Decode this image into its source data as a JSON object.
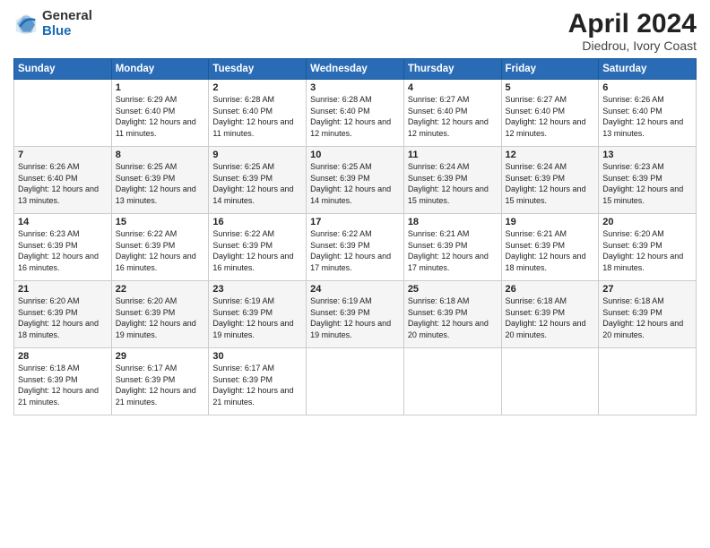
{
  "logo": {
    "line1": "General",
    "line2": "Blue"
  },
  "title": "April 2024",
  "subtitle": "Diedrou, Ivory Coast",
  "days_header": [
    "Sunday",
    "Monday",
    "Tuesday",
    "Wednesday",
    "Thursday",
    "Friday",
    "Saturday"
  ],
  "weeks": [
    [
      {
        "num": "",
        "sunrise": "",
        "sunset": "",
        "daylight": ""
      },
      {
        "num": "1",
        "sunrise": "Sunrise: 6:29 AM",
        "sunset": "Sunset: 6:40 PM",
        "daylight": "Daylight: 12 hours and 11 minutes."
      },
      {
        "num": "2",
        "sunrise": "Sunrise: 6:28 AM",
        "sunset": "Sunset: 6:40 PM",
        "daylight": "Daylight: 12 hours and 11 minutes."
      },
      {
        "num": "3",
        "sunrise": "Sunrise: 6:28 AM",
        "sunset": "Sunset: 6:40 PM",
        "daylight": "Daylight: 12 hours and 12 minutes."
      },
      {
        "num": "4",
        "sunrise": "Sunrise: 6:27 AM",
        "sunset": "Sunset: 6:40 PM",
        "daylight": "Daylight: 12 hours and 12 minutes."
      },
      {
        "num": "5",
        "sunrise": "Sunrise: 6:27 AM",
        "sunset": "Sunset: 6:40 PM",
        "daylight": "Daylight: 12 hours and 12 minutes."
      },
      {
        "num": "6",
        "sunrise": "Sunrise: 6:26 AM",
        "sunset": "Sunset: 6:40 PM",
        "daylight": "Daylight: 12 hours and 13 minutes."
      }
    ],
    [
      {
        "num": "7",
        "sunrise": "Sunrise: 6:26 AM",
        "sunset": "Sunset: 6:40 PM",
        "daylight": "Daylight: 12 hours and 13 minutes."
      },
      {
        "num": "8",
        "sunrise": "Sunrise: 6:25 AM",
        "sunset": "Sunset: 6:39 PM",
        "daylight": "Daylight: 12 hours and 13 minutes."
      },
      {
        "num": "9",
        "sunrise": "Sunrise: 6:25 AM",
        "sunset": "Sunset: 6:39 PM",
        "daylight": "Daylight: 12 hours and 14 minutes."
      },
      {
        "num": "10",
        "sunrise": "Sunrise: 6:25 AM",
        "sunset": "Sunset: 6:39 PM",
        "daylight": "Daylight: 12 hours and 14 minutes."
      },
      {
        "num": "11",
        "sunrise": "Sunrise: 6:24 AM",
        "sunset": "Sunset: 6:39 PM",
        "daylight": "Daylight: 12 hours and 15 minutes."
      },
      {
        "num": "12",
        "sunrise": "Sunrise: 6:24 AM",
        "sunset": "Sunset: 6:39 PM",
        "daylight": "Daylight: 12 hours and 15 minutes."
      },
      {
        "num": "13",
        "sunrise": "Sunrise: 6:23 AM",
        "sunset": "Sunset: 6:39 PM",
        "daylight": "Daylight: 12 hours and 15 minutes."
      }
    ],
    [
      {
        "num": "14",
        "sunrise": "Sunrise: 6:23 AM",
        "sunset": "Sunset: 6:39 PM",
        "daylight": "Daylight: 12 hours and 16 minutes."
      },
      {
        "num": "15",
        "sunrise": "Sunrise: 6:22 AM",
        "sunset": "Sunset: 6:39 PM",
        "daylight": "Daylight: 12 hours and 16 minutes."
      },
      {
        "num": "16",
        "sunrise": "Sunrise: 6:22 AM",
        "sunset": "Sunset: 6:39 PM",
        "daylight": "Daylight: 12 hours and 16 minutes."
      },
      {
        "num": "17",
        "sunrise": "Sunrise: 6:22 AM",
        "sunset": "Sunset: 6:39 PM",
        "daylight": "Daylight: 12 hours and 17 minutes."
      },
      {
        "num": "18",
        "sunrise": "Sunrise: 6:21 AM",
        "sunset": "Sunset: 6:39 PM",
        "daylight": "Daylight: 12 hours and 17 minutes."
      },
      {
        "num": "19",
        "sunrise": "Sunrise: 6:21 AM",
        "sunset": "Sunset: 6:39 PM",
        "daylight": "Daylight: 12 hours and 18 minutes."
      },
      {
        "num": "20",
        "sunrise": "Sunrise: 6:20 AM",
        "sunset": "Sunset: 6:39 PM",
        "daylight": "Daylight: 12 hours and 18 minutes."
      }
    ],
    [
      {
        "num": "21",
        "sunrise": "Sunrise: 6:20 AM",
        "sunset": "Sunset: 6:39 PM",
        "daylight": "Daylight: 12 hours and 18 minutes."
      },
      {
        "num": "22",
        "sunrise": "Sunrise: 6:20 AM",
        "sunset": "Sunset: 6:39 PM",
        "daylight": "Daylight: 12 hours and 19 minutes."
      },
      {
        "num": "23",
        "sunrise": "Sunrise: 6:19 AM",
        "sunset": "Sunset: 6:39 PM",
        "daylight": "Daylight: 12 hours and 19 minutes."
      },
      {
        "num": "24",
        "sunrise": "Sunrise: 6:19 AM",
        "sunset": "Sunset: 6:39 PM",
        "daylight": "Daylight: 12 hours and 19 minutes."
      },
      {
        "num": "25",
        "sunrise": "Sunrise: 6:18 AM",
        "sunset": "Sunset: 6:39 PM",
        "daylight": "Daylight: 12 hours and 20 minutes."
      },
      {
        "num": "26",
        "sunrise": "Sunrise: 6:18 AM",
        "sunset": "Sunset: 6:39 PM",
        "daylight": "Daylight: 12 hours and 20 minutes."
      },
      {
        "num": "27",
        "sunrise": "Sunrise: 6:18 AM",
        "sunset": "Sunset: 6:39 PM",
        "daylight": "Daylight: 12 hours and 20 minutes."
      }
    ],
    [
      {
        "num": "28",
        "sunrise": "Sunrise: 6:18 AM",
        "sunset": "Sunset: 6:39 PM",
        "daylight": "Daylight: 12 hours and 21 minutes."
      },
      {
        "num": "29",
        "sunrise": "Sunrise: 6:17 AM",
        "sunset": "Sunset: 6:39 PM",
        "daylight": "Daylight: 12 hours and 21 minutes."
      },
      {
        "num": "30",
        "sunrise": "Sunrise: 6:17 AM",
        "sunset": "Sunset: 6:39 PM",
        "daylight": "Daylight: 12 hours and 21 minutes."
      },
      {
        "num": "",
        "sunrise": "",
        "sunset": "",
        "daylight": ""
      },
      {
        "num": "",
        "sunrise": "",
        "sunset": "",
        "daylight": ""
      },
      {
        "num": "",
        "sunrise": "",
        "sunset": "",
        "daylight": ""
      },
      {
        "num": "",
        "sunrise": "",
        "sunset": "",
        "daylight": ""
      }
    ]
  ]
}
